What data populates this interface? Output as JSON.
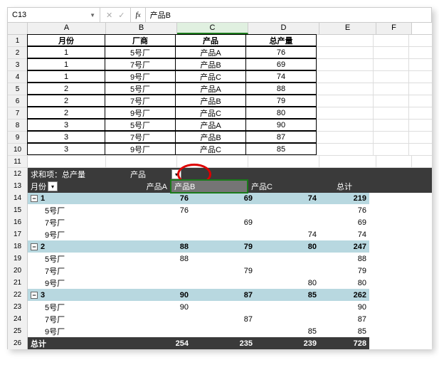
{
  "namebox": {
    "ref": "C13",
    "value": "产品B"
  },
  "columns": [
    "A",
    "B",
    "C",
    "D",
    "E",
    "F"
  ],
  "headers": {
    "A": "月份",
    "B": "厂商",
    "C": "产品",
    "D": "总产量"
  },
  "data_rows": [
    {
      "n": 2,
      "A": "1",
      "B": "5号厂",
      "C": "产品A",
      "D": "76"
    },
    {
      "n": 3,
      "A": "1",
      "B": "7号厂",
      "C": "产品B",
      "D": "69"
    },
    {
      "n": 4,
      "A": "1",
      "B": "9号厂",
      "C": "产品C",
      "D": "74"
    },
    {
      "n": 5,
      "A": "2",
      "B": "5号厂",
      "C": "产品A",
      "D": "88"
    },
    {
      "n": 6,
      "A": "2",
      "B": "7号厂",
      "C": "产品B",
      "D": "79"
    },
    {
      "n": 7,
      "A": "2",
      "B": "9号厂",
      "C": "产品C",
      "D": "80"
    },
    {
      "n": 8,
      "A": "3",
      "B": "5号厂",
      "C": "产品A",
      "D": "90"
    },
    {
      "n": 9,
      "A": "3",
      "B": "7号厂",
      "C": "产品B",
      "D": "87"
    },
    {
      "n": 10,
      "A": "3",
      "B": "9号厂",
      "C": "产品C",
      "D": "85"
    }
  ],
  "pivot": {
    "measure": "求和项：总产量",
    "col_field": "产品",
    "row_field": "月份",
    "col_labels": [
      "产品A",
      "产品B",
      "产品C",
      "总计"
    ],
    "groups": [
      {
        "n": 14,
        "key": "1",
        "a": "76",
        "b": "69",
        "c": "74",
        "t": "219",
        "rows": [
          {
            "n": 15,
            "lbl": "5号厂",
            "a": "76",
            "b": "",
            "c": "",
            "t": "76"
          },
          {
            "n": 16,
            "lbl": "7号厂",
            "a": "",
            "b": "69",
            "c": "",
            "t": "69"
          },
          {
            "n": 17,
            "lbl": "9号厂",
            "a": "",
            "b": "",
            "c": "74",
            "t": "74"
          }
        ]
      },
      {
        "n": 18,
        "key": "2",
        "a": "88",
        "b": "79",
        "c": "80",
        "t": "247",
        "rows": [
          {
            "n": 19,
            "lbl": "5号厂",
            "a": "88",
            "b": "",
            "c": "",
            "t": "88"
          },
          {
            "n": 20,
            "lbl": "7号厂",
            "a": "",
            "b": "79",
            "c": "",
            "t": "79"
          },
          {
            "n": 21,
            "lbl": "9号厂",
            "a": "",
            "b": "",
            "c": "80",
            "t": "80"
          }
        ]
      },
      {
        "n": 22,
        "key": "3",
        "a": "90",
        "b": "87",
        "c": "85",
        "t": "262",
        "rows": [
          {
            "n": 23,
            "lbl": "5号厂",
            "a": "90",
            "b": "",
            "c": "",
            "t": "90"
          },
          {
            "n": 24,
            "lbl": "7号厂",
            "a": "",
            "b": "87",
            "c": "",
            "t": "87"
          },
          {
            "n": 25,
            "lbl": "9号厂",
            "a": "",
            "b": "",
            "c": "85",
            "t": "85"
          }
        ]
      }
    ],
    "grand": {
      "n": 26,
      "lbl": "总计",
      "a": "254",
      "b": "235",
      "c": "239",
      "t": "728"
    }
  }
}
